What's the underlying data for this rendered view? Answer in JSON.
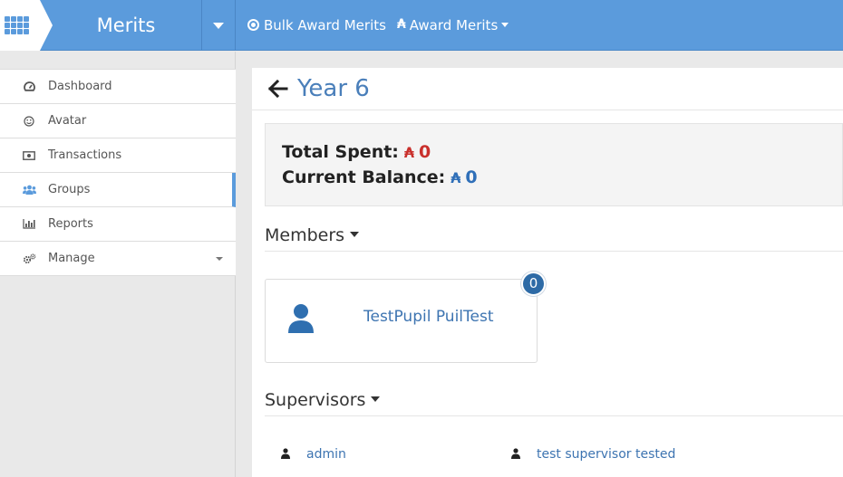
{
  "app": {
    "title": "Merits"
  },
  "topbar": {
    "bulk_award": "Bulk Award Merits",
    "award": "Award Merits",
    "merit_symbol": "₳"
  },
  "sidebar": {
    "items": [
      {
        "label": "Dashboard",
        "icon": "dashboard-icon"
      },
      {
        "label": "Avatar",
        "icon": "smile-icon"
      },
      {
        "label": "Transactions",
        "icon": "money-icon"
      },
      {
        "label": "Groups",
        "icon": "users-icon",
        "active": true
      },
      {
        "label": "Reports",
        "icon": "bar-chart-icon"
      },
      {
        "label": "Manage",
        "icon": "gears-icon",
        "has_dropdown": true
      }
    ]
  },
  "page": {
    "title": "Year 6"
  },
  "summary": {
    "spent_label": "Total Spent:",
    "spent_value": "0",
    "balance_label": "Current Balance:",
    "balance_value": "0"
  },
  "members": {
    "heading": "Members",
    "list": [
      {
        "name": "TestPupil PuilTest",
        "badge": "0"
      }
    ]
  },
  "supervisors": {
    "heading": "Supervisors",
    "list": [
      {
        "name": "admin"
      },
      {
        "name": "test supervisor tested"
      }
    ]
  },
  "colors": {
    "topbar": "#5b9bdc",
    "title_blue": "#4a7fba",
    "spent_red": "#c9302c",
    "balance_blue": "#2f6fb8",
    "badge_blue": "#2d6aa6"
  }
}
